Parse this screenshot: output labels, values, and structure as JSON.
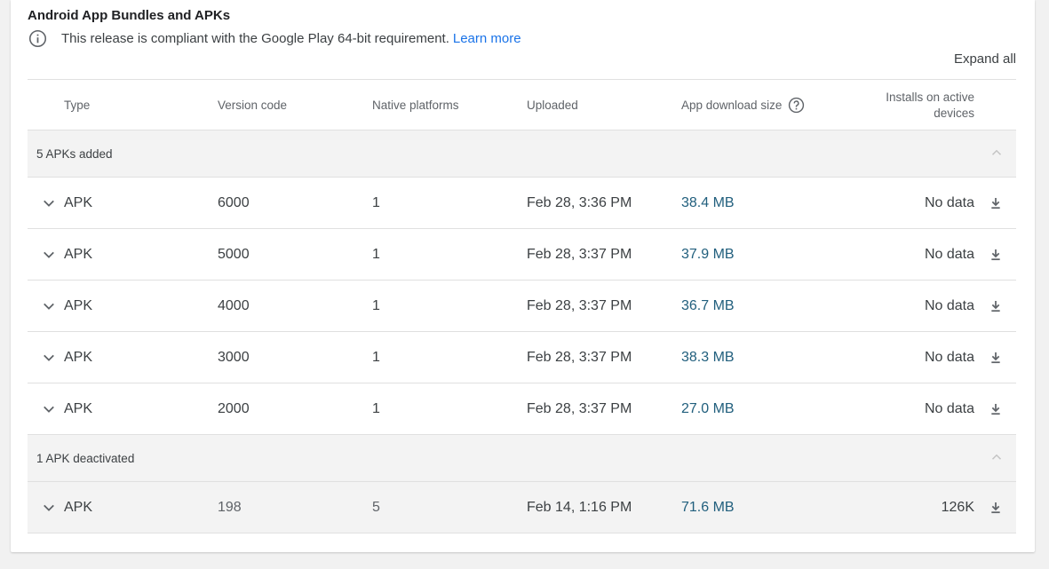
{
  "section": {
    "title": "Android App Bundles and APKs",
    "notice_text": "This release is compliant with the Google Play 64-bit requirement.",
    "learn_more": "Learn more",
    "expand_all": "Expand all"
  },
  "table": {
    "headers": {
      "type": "Type",
      "version": "Version code",
      "native": "Native platforms",
      "uploaded": "Uploaded",
      "size": "App download size",
      "installs_line1": "Installs on active",
      "installs_line2": "devices"
    },
    "groups": [
      {
        "label": "5 APKs added",
        "rows": [
          {
            "type": "APK",
            "version": "6000",
            "native": "1",
            "uploaded": "Feb 28, 3:36 PM",
            "size": "38.4 MB",
            "installs": "No data"
          },
          {
            "type": "APK",
            "version": "5000",
            "native": "1",
            "uploaded": "Feb 28, 3:37 PM",
            "size": "37.9 MB",
            "installs": "No data"
          },
          {
            "type": "APK",
            "version": "4000",
            "native": "1",
            "uploaded": "Feb 28, 3:37 PM",
            "size": "36.7 MB",
            "installs": "No data"
          },
          {
            "type": "APK",
            "version": "3000",
            "native": "1",
            "uploaded": "Feb 28, 3:37 PM",
            "size": "38.3 MB",
            "installs": "No data"
          },
          {
            "type": "APK",
            "version": "2000",
            "native": "1",
            "uploaded": "Feb 28, 3:37 PM",
            "size": "27.0 MB",
            "installs": "No data"
          }
        ]
      },
      {
        "label": "1 APK deactivated",
        "rows": [
          {
            "type": "APK",
            "version": "198",
            "native": "5",
            "uploaded": "Feb 14, 1:16 PM",
            "size": "71.6 MB",
            "installs": "126K"
          }
        ]
      }
    ]
  },
  "icons": {
    "info": "info-icon",
    "help": "help-circle-icon",
    "collapse": "chevron-up-icon",
    "expand_row": "chevron-down-icon",
    "download": "download-icon"
  },
  "colors": {
    "link": "#1a73e8",
    "size_text": "#215f7d",
    "group_bg": "#f3f3f3"
  }
}
